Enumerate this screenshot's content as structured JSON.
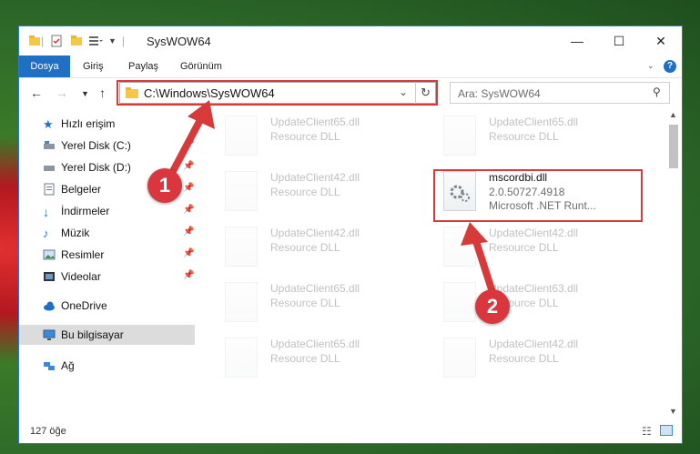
{
  "window": {
    "title": "SysWOW64",
    "controls": {
      "minimize": "—",
      "maximize": "☐",
      "close": "✕"
    }
  },
  "ribbon": {
    "tabs": [
      "Dosya",
      "Giriş",
      "Paylaş",
      "Görünüm"
    ],
    "help": "?"
  },
  "nav": {
    "address": "C:\\Windows\\SysWOW64",
    "search_placeholder": "Ara: SysWOW64"
  },
  "sidebar": {
    "items": [
      {
        "label": "Hızlı erişim",
        "icon": "star-icon",
        "pinned": false
      },
      {
        "label": "Yerel Disk (C:)",
        "icon": "drive-icon",
        "pinned": true
      },
      {
        "label": "Yerel Disk (D:)",
        "icon": "drive-icon",
        "pinned": true
      },
      {
        "label": "Belgeler",
        "icon": "document-icon",
        "pinned": true
      },
      {
        "label": "İndirmeler",
        "icon": "download-icon",
        "pinned": true
      },
      {
        "label": "Müzik",
        "icon": "music-icon",
        "pinned": true
      },
      {
        "label": "Resimler",
        "icon": "image-icon",
        "pinned": true
      },
      {
        "label": "Videolar",
        "icon": "video-icon",
        "pinned": true
      },
      {
        "label": "OneDrive",
        "icon": "cloud-icon",
        "pinned": false
      },
      {
        "label": "Bu bilgisayar",
        "icon": "computer-icon",
        "pinned": false,
        "selected": true
      },
      {
        "label": "Ağ",
        "icon": "network-icon",
        "pinned": false
      }
    ]
  },
  "files": {
    "left": [
      {
        "name": "UpdateClient65.dll",
        "type": "Resource DLL"
      },
      {
        "name": "UpdateClient42.dll",
        "type": "Resource DLL"
      },
      {
        "name": "UpdateClient42.dll",
        "type": "Resource DLL"
      },
      {
        "name": "UpdateClient65.dll",
        "type": "Resource DLL"
      },
      {
        "name": "UpdateClient65.dll",
        "type": "Resource DLL"
      }
    ],
    "right": [
      {
        "name": "UpdateClient65.dll",
        "type": "Resource DLL"
      },
      {
        "name": "mscordbi.dll",
        "version": "2.0.50727.4918",
        "company": "Microsoft .NET Runt..."
      },
      {
        "name": "UpdateClient42.dll",
        "type": "Resource DLL"
      },
      {
        "name": "UpdateClient63.dll",
        "type": "Resource DLL"
      },
      {
        "name": "UpdateClient42.dll",
        "type": "Resource DLL"
      }
    ]
  },
  "status": {
    "count": "127 öğe"
  },
  "annotations": {
    "step1": "1",
    "step2": "2"
  },
  "colors": {
    "accent": "#1f6fc5",
    "highlight_border": "#d83a3a",
    "badge": "#d9363e"
  }
}
